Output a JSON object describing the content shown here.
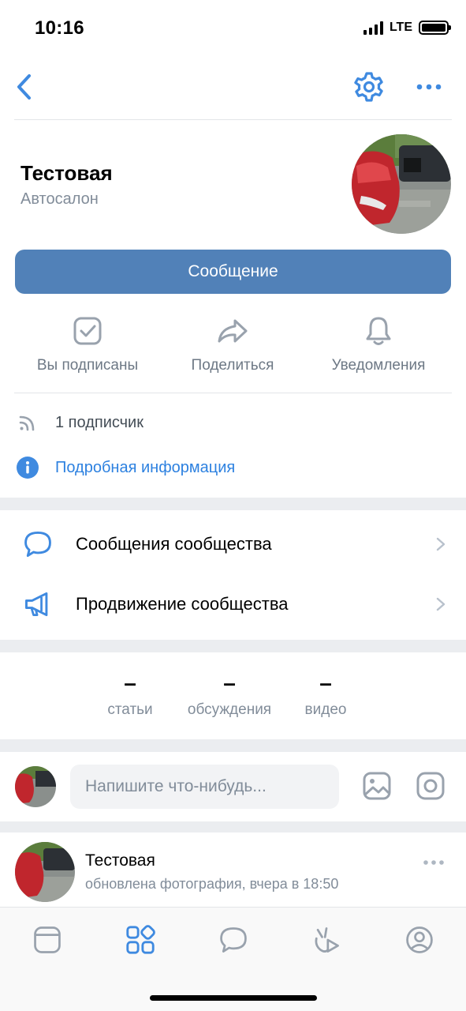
{
  "status_bar": {
    "time": "10:16",
    "network": "LTE"
  },
  "profile": {
    "name": "Тестовая",
    "category": "Автосалон",
    "message_button": "Сообщение"
  },
  "actions": [
    {
      "label": "Вы подписаны",
      "icon": "subscribed-check-icon"
    },
    {
      "label": "Поделиться",
      "icon": "share-icon"
    },
    {
      "label": "Уведомления",
      "icon": "bell-icon"
    }
  ],
  "info": {
    "followers": "1 подписчик",
    "details_link": "Подробная информация"
  },
  "menu": [
    {
      "label": "Сообщения сообщества",
      "icon": "chat-bubble-icon"
    },
    {
      "label": "Продвижение сообщества",
      "icon": "megaphone-icon"
    }
  ],
  "counters": [
    {
      "value": "–",
      "label": "статьи"
    },
    {
      "value": "–",
      "label": "обсуждения"
    },
    {
      "value": "–",
      "label": "видео"
    }
  ],
  "composer": {
    "placeholder": "Напишите что-нибудь..."
  },
  "post": {
    "author": "Тестовая",
    "meta": "обновлена фотография, вчера в 18:50"
  },
  "colors": {
    "accent": "#5181b8",
    "icon": "#3f8ae0",
    "secondary_text": "#818c99",
    "separator": "#ebedf0"
  },
  "tabbar": [
    "news-icon",
    "services-icon",
    "messages-icon",
    "clips-icon",
    "profile-icon"
  ]
}
